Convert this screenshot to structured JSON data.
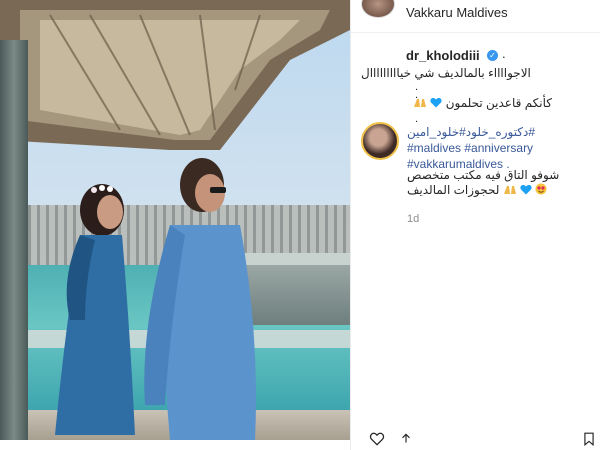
{
  "post": {
    "location": "Vakkaru Maldives",
    "username": "dr_kholodiii",
    "username_suffix": ".",
    "caption_line1": "الاجوااااء بالمالديف شي خيااااااااال",
    "dot1": ".",
    "dot2": ".",
    "caption_line2": "كأنكم قاعدين تحلمون",
    "dot3": "."
  },
  "comment": {
    "hashtags_rtl": "#دكتوره_خلود#خلود_امين",
    "hashtag_2": "#maldives #anniversary",
    "hashtag_3": "#vakkarumaldives .",
    "text_line1": "شوفو التاق فيه مكتب متخصص",
    "text_line2": "لحجوزات المالديف",
    "time": "1d"
  },
  "icons": {
    "verified": "verified-badge-icon",
    "heart": "heart-icon",
    "heart_eyes": "heart-eyes-emoji-icon",
    "hands": "hands-emoji-icon",
    "like": "like-heart-icon",
    "share": "share-icon",
    "bookmark": "bookmark-icon"
  },
  "colors": {
    "link": "#385898",
    "verified": "#3897f0",
    "heart_emoji": "#1da1f2",
    "muted": "#8e8e8e"
  }
}
